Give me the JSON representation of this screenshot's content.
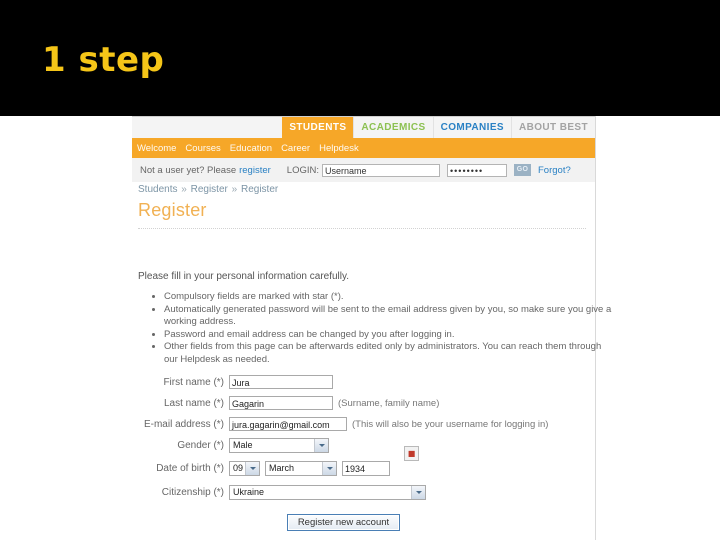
{
  "slide": {
    "title": "1 step",
    "title_color": "#f5c518",
    "banner_color": "#000000"
  },
  "site": {
    "tabs": [
      {
        "label": "STUDENTS",
        "state": "active",
        "color": "#ffffff"
      },
      {
        "label": "ACADEMICS",
        "state": "inactive",
        "color": "#8cc152"
      },
      {
        "label": "COMPANIES",
        "state": "inactive",
        "color": "#2a81c4"
      },
      {
        "label": "ABOUT BEST",
        "state": "inactive",
        "color": "#a3a3a3"
      }
    ],
    "subnav": [
      {
        "label": "Welcome"
      },
      {
        "label": "Courses"
      },
      {
        "label": "Education"
      },
      {
        "label": "Career"
      },
      {
        "label": "Helpdesk"
      }
    ],
    "accent_color": "#f6a728"
  },
  "loginbar": {
    "prompt": "Not a user yet? Please",
    "register_link": "register",
    "login_label": "LOGIN:",
    "username_value": "Username",
    "password_value": "••••••••",
    "go_label": "GO",
    "forgot_link": "Forgot?"
  },
  "breadcrumb": {
    "item1": "Students",
    "sep1": "»",
    "item2": "Register",
    "sep2": "»",
    "item3": "Register"
  },
  "page": {
    "heading": "Register",
    "intro": "Please fill in your personal information carefully.",
    "bullets": [
      "Compulsory fields are marked with star (*).",
      "Automatically generated password will be sent to the email address given by you, so make sure you give a working address.",
      "Password and email address can be changed by you after logging in.",
      "Other fields from this page can be afterwards edited only by administrators. You can reach them through our Helpdesk as needed."
    ]
  },
  "form": {
    "first_name": {
      "label": "First name (*)",
      "value": "Jura"
    },
    "last_name": {
      "label": "Last name (*)",
      "value": "Gagarin",
      "hint": "(Surname, family name)"
    },
    "email": {
      "label": "E-mail address (*)",
      "value": "jura.gagarin@gmail.com",
      "hint": "(This will also be your username for logging in)"
    },
    "gender": {
      "label": "Gender (*)",
      "value": "Male"
    },
    "date_of_birth": {
      "label": "Date of birth (*)",
      "day": "09",
      "month": "March",
      "year": "1934",
      "calendar_icon": "broken-image"
    },
    "citizenship": {
      "label": "Citizenship (*)",
      "value": "Ukraine"
    },
    "submit_label": "Register new account"
  }
}
